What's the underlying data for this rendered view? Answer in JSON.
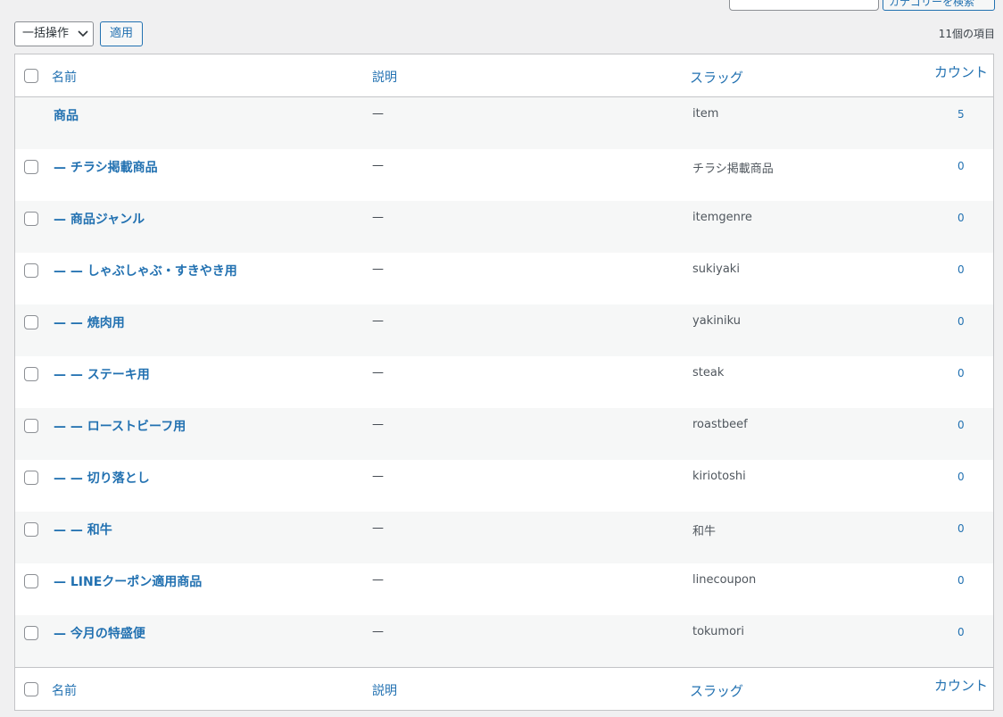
{
  "top": {
    "search_button_label": "カテゴリーを検索"
  },
  "tablenav": {
    "bulk_action_label": "一括操作",
    "apply_label": "適用",
    "item_count": "11個の項目"
  },
  "columns": {
    "name": "名前",
    "description": "説明",
    "slug": "スラッグ",
    "count": "カウント"
  },
  "rows": [
    {
      "name": "商品",
      "description": "—",
      "slug": "item",
      "count": "5",
      "checkbox": false
    },
    {
      "name": "— チラシ掲載商品",
      "description": "—",
      "slug": "チラシ掲載商品",
      "count": "0",
      "checkbox": true
    },
    {
      "name": "— 商品ジャンル",
      "description": "—",
      "slug": "itemgenre",
      "count": "0",
      "checkbox": true
    },
    {
      "name": "— — しゃぶしゃぶ・すきやき用",
      "description": "—",
      "slug": "sukiyaki",
      "count": "0",
      "checkbox": true
    },
    {
      "name": "— — 焼肉用",
      "description": "—",
      "slug": "yakiniku",
      "count": "0",
      "checkbox": true
    },
    {
      "name": "— — ステーキ用",
      "description": "—",
      "slug": "steak",
      "count": "0",
      "checkbox": true
    },
    {
      "name": "— — ローストビーフ用",
      "description": "—",
      "slug": "roastbeef",
      "count": "0",
      "checkbox": true
    },
    {
      "name": "— — 切り落とし",
      "description": "—",
      "slug": "kiriotoshi",
      "count": "0",
      "checkbox": true
    },
    {
      "name": "— — 和牛",
      "description": "—",
      "slug": "和牛",
      "count": "0",
      "checkbox": true
    },
    {
      "name": "— LINEクーポン適用商品",
      "description": "—",
      "slug": "linecoupon",
      "count": "0",
      "checkbox": true
    },
    {
      "name": "— 今月の特盛便",
      "description": "—",
      "slug": "tokumori",
      "count": "0",
      "checkbox": true
    }
  ]
}
